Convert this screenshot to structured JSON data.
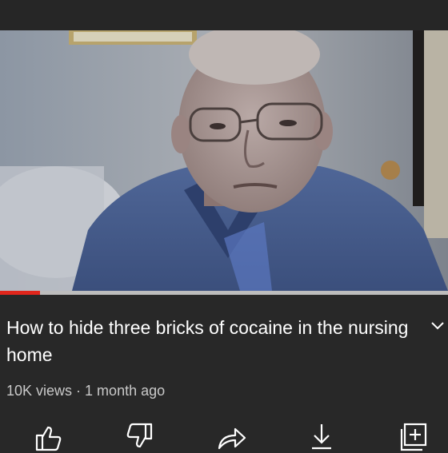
{
  "video": {
    "title": "How to hide three bricks of cocaine in the nursing home",
    "views": "10K views",
    "separator": "·",
    "age": "1 month ago",
    "progress": 0.09
  },
  "actions": [
    {
      "icon": "thumbs-up-icon"
    },
    {
      "icon": "thumbs-down-icon"
    },
    {
      "icon": "share-icon"
    },
    {
      "icon": "download-icon"
    },
    {
      "icon": "save-to-playlist-icon"
    }
  ],
  "colors": {
    "background": "#282828",
    "progress_played": "#e1261c",
    "progress_track": "#bdbdbd",
    "meta_text": "#c9c9c9"
  }
}
